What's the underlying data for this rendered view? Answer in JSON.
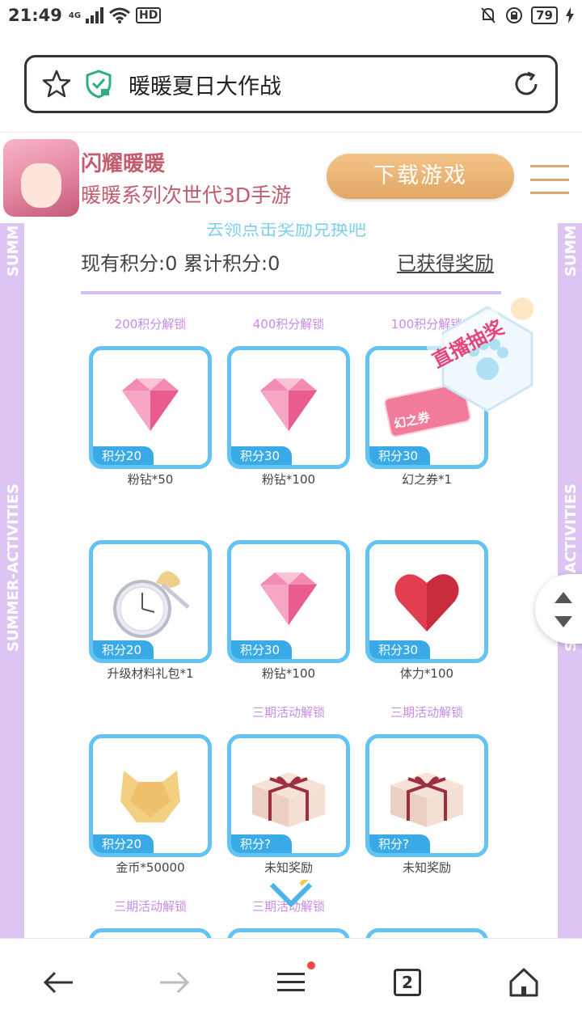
{
  "status_bar": {
    "time": "21:49",
    "network": "4G",
    "hd": "HD",
    "battery": "79"
  },
  "url_bar": {
    "title": "暖暖夏日大作战"
  },
  "banner": {
    "app_name": "闪耀暖暖",
    "app_subtitle": "暖暖系列次世代3D手游",
    "download_label": "下载游戏"
  },
  "activity": {
    "side_text": "SUMMER-ACTIVITIES",
    "side_text_short": "SUMM",
    "partial_heading": "去领点击奖励兑换吧",
    "points_text": "现有积分:0 累计积分:0",
    "earned_link": "已获得奖励",
    "lottery_label": "直播抽奖",
    "rows": [
      {
        "unlock": [
          "200积分解锁",
          "400积分解锁",
          "100积分解锁"
        ],
        "items": [
          {
            "badge": "积分20",
            "name": "粉钻*50",
            "icon": "pink-diamond"
          },
          {
            "badge": "积分30",
            "name": "粉钻*100",
            "icon": "pink-diamond"
          },
          {
            "badge": "积分30",
            "name": "幻之券*1",
            "icon": "ticket",
            "ticket_text": "幻之券"
          }
        ]
      },
      {
        "unlock": [
          "",
          "",
          ""
        ],
        "items": [
          {
            "badge": "积分20",
            "name": "升级材料礼包*1",
            "icon": "pocket-watch"
          },
          {
            "badge": "积分30",
            "name": "粉钻*100",
            "icon": "pink-diamond"
          },
          {
            "badge": "积分30",
            "name": "体力*100",
            "icon": "red-heart"
          }
        ]
      },
      {
        "unlock": [
          "",
          "三期活动解锁",
          "三期活动解锁"
        ],
        "items": [
          {
            "badge": "积分20",
            "name": "金币*50000",
            "icon": "gold-coin"
          },
          {
            "badge": "积分?",
            "name": "未知奖励",
            "icon": "gift-box"
          },
          {
            "badge": "积分?",
            "name": "未知奖励",
            "icon": "gift-box"
          }
        ]
      }
    ],
    "next_unlock": [
      "三期活动解锁",
      "三期活动解锁"
    ]
  },
  "bottom_nav": {
    "tabs_count": "2"
  },
  "colors": {
    "card_border": "#63c3f2",
    "badge": "#3aaae6",
    "accent_purple": "#c98be6",
    "brand_pink": "#c15d6f"
  }
}
